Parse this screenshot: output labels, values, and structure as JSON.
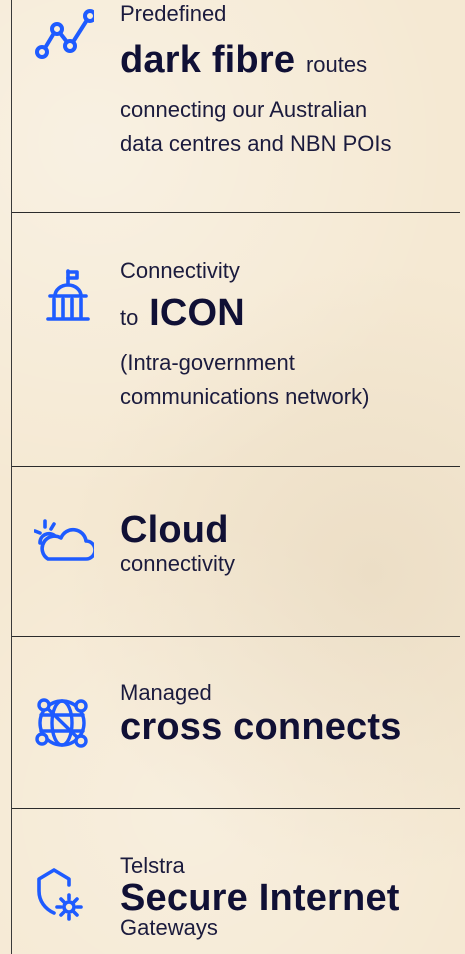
{
  "features": [
    {
      "icon": "route-graph-icon",
      "prefix": "Predefined",
      "headline": "dark fibre",
      "headline_suffix": "routes",
      "description_line1": "connecting our Australian",
      "description_line2": "data centres and NBN POIs"
    },
    {
      "icon": "government-building-icon",
      "prefix": "Connectivity",
      "headline_prefix": "to",
      "headline": "ICON",
      "description_line1": "(Intra-government",
      "description_line2": "communications network)"
    },
    {
      "icon": "cloud-icon",
      "headline": "Cloud",
      "suffix": "connectivity"
    },
    {
      "icon": "network-globe-icon",
      "prefix": "Managed",
      "headline": "cross connects"
    },
    {
      "icon": "shield-gear-icon",
      "prefix": "Telstra",
      "headline": "Secure Internet",
      "suffix": "Gateways"
    }
  ],
  "colors": {
    "accent_blue": "#1e5bff",
    "text": "#14143a",
    "background": "#f5e9d3",
    "divider": "#2b2b2b"
  }
}
